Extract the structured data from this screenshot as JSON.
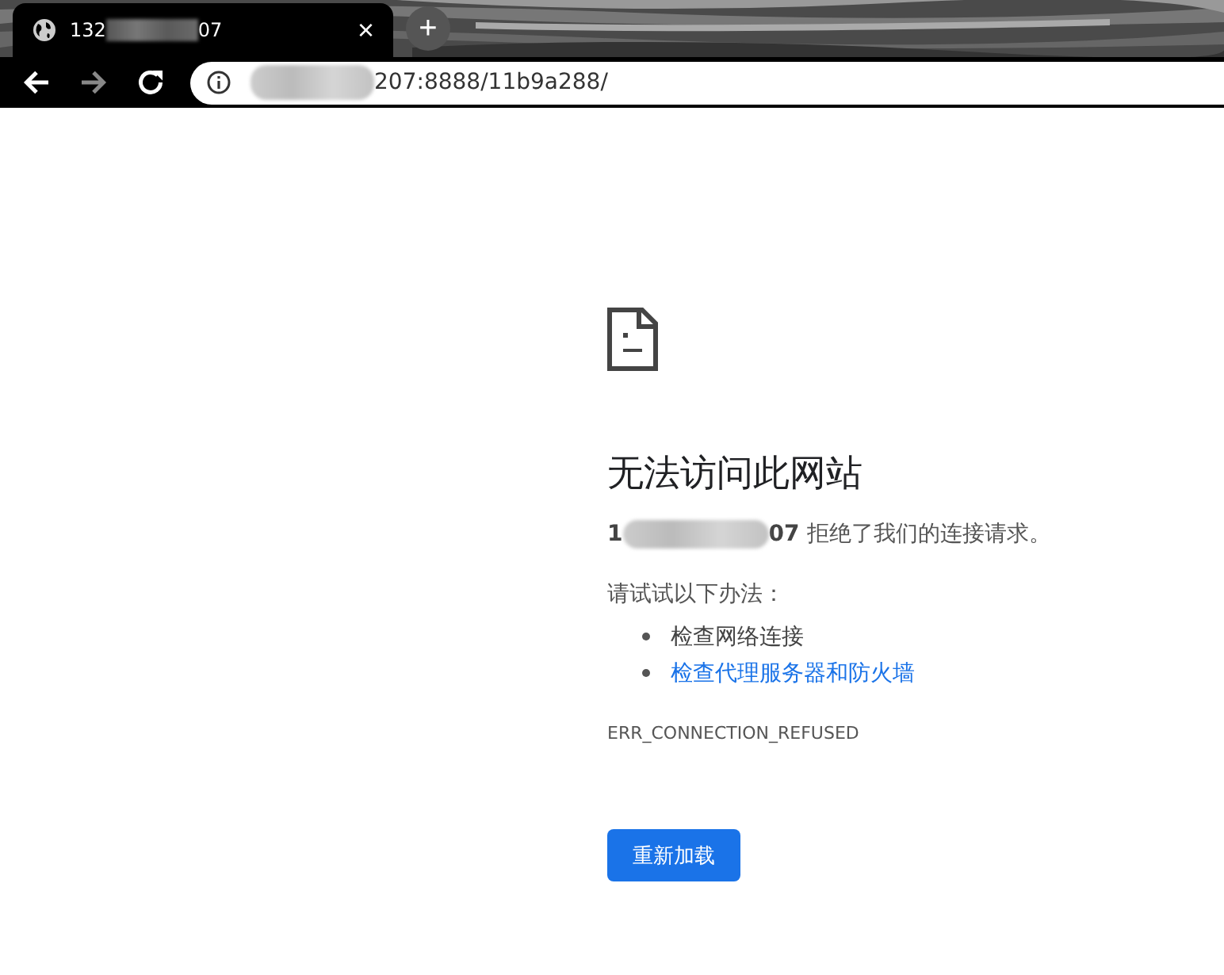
{
  "tab": {
    "title_start": "132",
    "title_end": "07",
    "close": "×"
  },
  "new_tab": "+",
  "address": {
    "visible_end": "207:8888/11b9a288/"
  },
  "error": {
    "title": "无法访问此网站",
    "host_start": "1",
    "host_end": "07",
    "message": "拒绝了我们的连接请求。",
    "suggestion_intro": "请试试以下办法：",
    "suggestions": [
      {
        "text": "检查网络连接",
        "kind": "text"
      },
      {
        "text": "检查代理服务器和防火墙",
        "kind": "link"
      }
    ],
    "code": "ERR_CONNECTION_REFUSED",
    "button": "重新加载"
  }
}
